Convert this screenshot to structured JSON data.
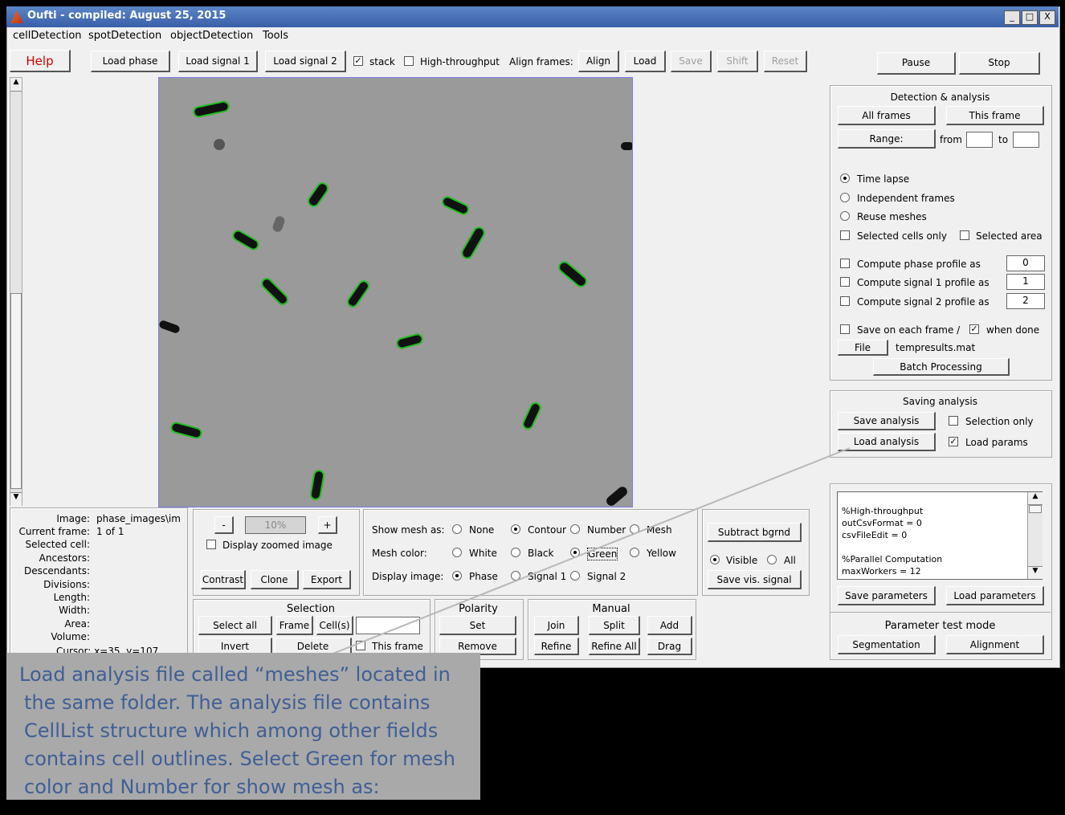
{
  "window": {
    "title": "Oufti - compiled:  August 25, 2015",
    "controls": [
      "_",
      "□",
      "X"
    ]
  },
  "menu": [
    "cellDetection",
    "spotDetection",
    "objectDetection",
    "Tools"
  ],
  "toolbar": {
    "help": "Help",
    "load_phase": "Load phase",
    "load_signal1": "Load signal 1",
    "load_signal2": "Load signal 2",
    "stack": "stack",
    "high_throughput": "High-throughput",
    "align_frames": "Align frames:",
    "align": "Align",
    "load": "Load",
    "save": "Save",
    "shift": "Shift",
    "reset": "Reset",
    "pause": "Pause",
    "stop": "Stop"
  },
  "detection": {
    "title": "Detection & analysis",
    "all_frames": "All frames",
    "this_frame": "This frame",
    "range": "Range:",
    "from": "from",
    "to": "to",
    "time_lapse": "Time lapse",
    "independent": "Independent frames",
    "reuse": "Reuse meshes",
    "selected_cells": "Selected cells only",
    "selected_area": "Selected area",
    "phase_profile": "Compute phase profile as",
    "signal1_profile": "Compute signal 1 profile as",
    "signal2_profile": "Compute signal 2 profile as",
    "phase_val": "0",
    "sig1_val": "1",
    "sig2_val": "2",
    "save_each": "Save on each frame /",
    "when_done": "when done",
    "file": "File",
    "filename": "tempresults.mat",
    "batch": "Batch Processing"
  },
  "saving": {
    "title": "Saving analysis",
    "save_analysis": "Save analysis",
    "selection_only": "Selection only",
    "load_analysis": "Load analysis",
    "load_params": "Load params"
  },
  "params": {
    "text": [
      "%High-throughput",
      "outCsvFormat = 0",
      "csvFileEdit = 0",
      "",
      "%Parallel Computation",
      "maxWorkers = 12"
    ],
    "save": "Save parameters",
    "load": "Load parameters",
    "test_title": "Parameter test mode",
    "segmentation": "Segmentation",
    "alignment": "Alignment"
  },
  "info": {
    "labels": [
      "Image:",
      "Current frame:",
      "Selected cell:",
      "Ancestors:",
      "Descendants:",
      "Divisions:",
      "Length:",
      "Width:",
      "Area:",
      "Volume:"
    ],
    "values": [
      "phase_images\\im",
      "1 of 1",
      "",
      "",
      "",
      "",
      "",
      "",
      "",
      ""
    ],
    "cursor": "Cursor: x=35, y=107"
  },
  "zoom": {
    "minus": "-",
    "value": "10%",
    "plus": "+",
    "display_zoomed": "Display zoomed image",
    "contrast": "Contrast",
    "clone": "Clone",
    "export": "Export"
  },
  "display": {
    "show_mesh": "Show mesh as:",
    "none": "None",
    "contour": "Contour",
    "number": "Number",
    "mesh": "Mesh",
    "mesh_color": "Mesh color:",
    "white": "White",
    "black": "Black",
    "green": "Green",
    "yellow": "Yellow",
    "display_image": "Display image:",
    "phase": "Phase",
    "signal1": "Signal 1",
    "signal2": "Signal 2"
  },
  "bgrnd": {
    "subtract": "Subtract bgrnd",
    "visible": "Visible",
    "all": "All",
    "save_vis": "Save vis. signal"
  },
  "selection": {
    "title": "Selection",
    "select_all": "Select all",
    "frame": "Frame",
    "cells": "Cell(s)",
    "invert": "Invert",
    "delete": "Delete",
    "this_frame": "This frame"
  },
  "polarity": {
    "title": "Polarity",
    "set": "Set",
    "remove": "Remove"
  },
  "manual": {
    "title": "Manual",
    "join": "Join",
    "split": "Split",
    "add": "Add",
    "refine": "Refine",
    "refine_all": "Refine All",
    "drag": "Drag"
  },
  "callout": {
    "lines": [
      "Load analysis file called “meshes” located in",
      "the same folder.  The analysis file contains",
      "CellList  structure  which among other fields",
      "contains cell outlines.   Select Green for mesh",
      "color and Number for show mesh as:"
    ]
  },
  "colors": {
    "title_bar": "#3a5fa8",
    "help_text": "#cc0000",
    "mesh": "#1fbf1f",
    "callout_bg": "#a9a9a9",
    "callout_text": "#3f5f95"
  }
}
